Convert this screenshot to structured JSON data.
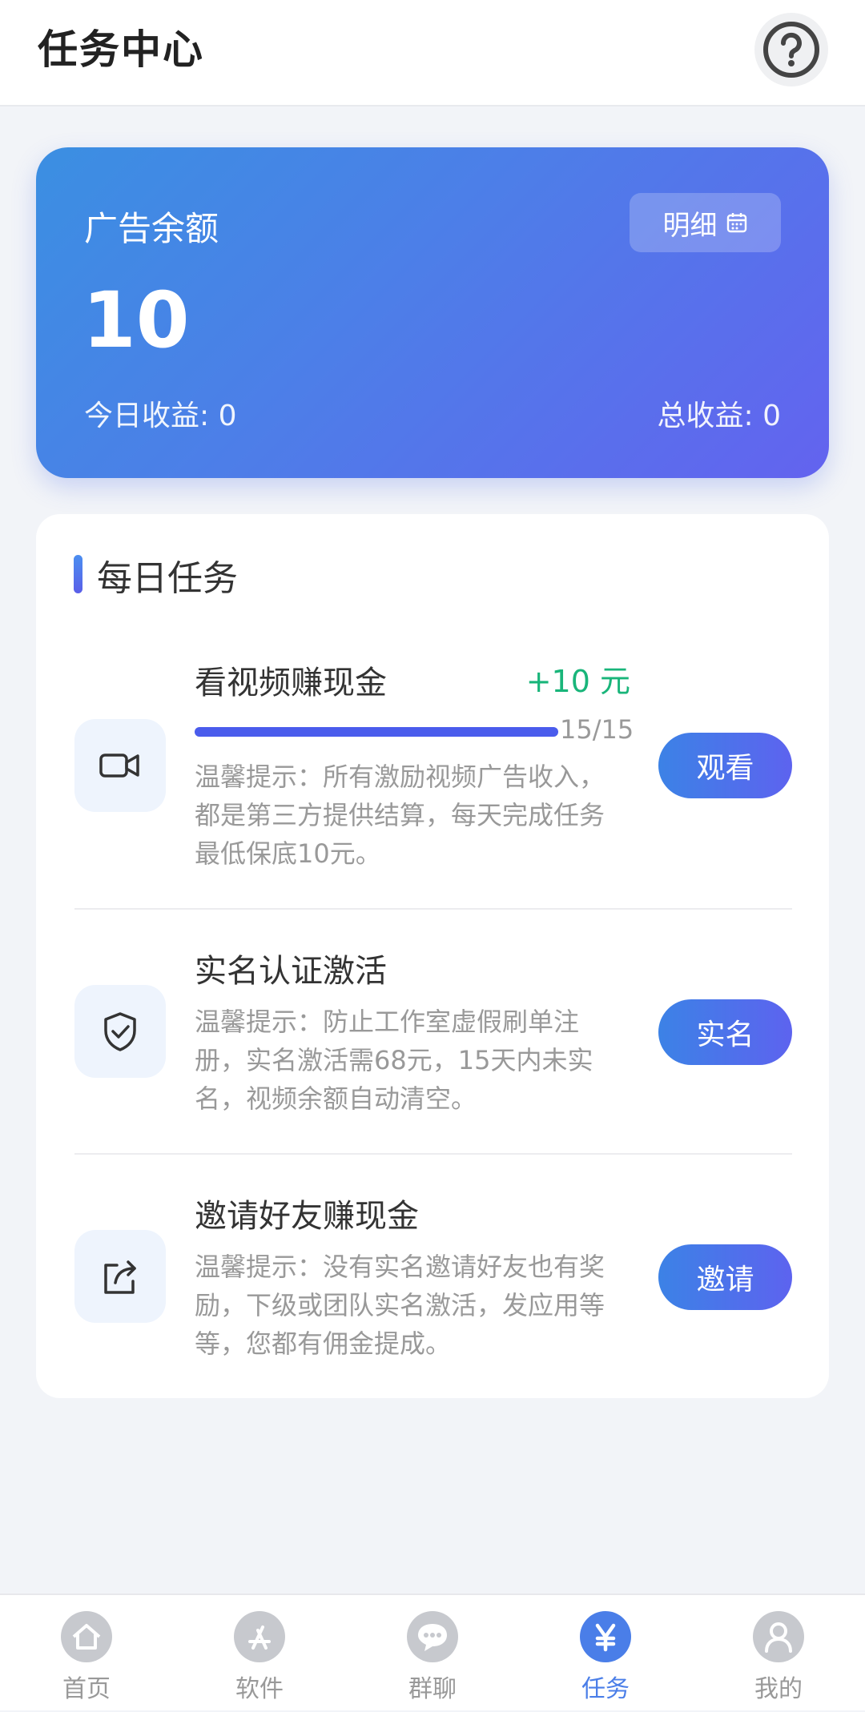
{
  "header": {
    "title": "任务中心",
    "help_icon": "question-circle-icon"
  },
  "balance": {
    "label": "广告余额",
    "value": "10",
    "detail_label": "明细",
    "detail_icon": "calendar-icon",
    "today": "今日收益: 0",
    "total": "总收益: 0"
  },
  "daily": {
    "title": "每日任务",
    "tasks": [
      {
        "name": "看视频赚现金",
        "reward": "+10 元",
        "progress_text": "15/15",
        "progress": 1.0,
        "desc": "温馨提示：所有激励视频广告收入，都是第三方提供结算，每天完成任务最低保底10元。",
        "button": "观看",
        "icon": "video-camera-icon"
      },
      {
        "name": "实名认证激活",
        "desc": "温馨提示：防止工作室虚假刷单注册，实名激活需68元，15天内未实名，视频余额自动清空。",
        "button": "实名",
        "icon": "shield-check-icon"
      },
      {
        "name": "邀请好友赚现金",
        "desc": "温馨提示：没有实名邀请好友也有奖励，下级或团队实名激活，发应用等等，您都有佣金提成。",
        "button": "邀请",
        "icon": "share-icon"
      }
    ]
  },
  "tabbar": [
    {
      "label": "首页",
      "icon": "home-icon",
      "active": false
    },
    {
      "label": "软件",
      "icon": "app-store-icon",
      "active": false
    },
    {
      "label": "群聊",
      "icon": "chat-icon",
      "active": false
    },
    {
      "label": "任务",
      "icon": "yen-icon",
      "active": true
    },
    {
      "label": "我的",
      "icon": "user-icon",
      "active": false
    }
  ],
  "colors": {
    "accent": "#4a7ee8",
    "reward": "#19b57a",
    "card_start": "#3b8fe2",
    "card_end": "#6363ef"
  }
}
